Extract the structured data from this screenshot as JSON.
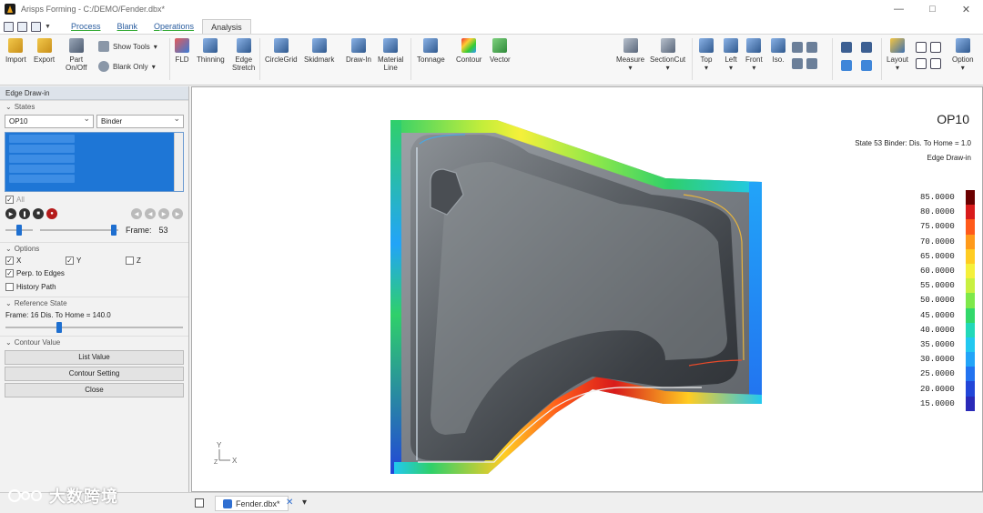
{
  "window": {
    "title": "Arisps Forming - C:/DEMO/Fender.dbx*",
    "minimize": "—",
    "maximize": "□",
    "close": "✕"
  },
  "menu": {
    "tabs": [
      "Process",
      "Blank",
      "Operations",
      "Analysis"
    ],
    "active_tab": "Analysis"
  },
  "ribbon": {
    "import": "Import",
    "export": "Export",
    "part_onoff": [
      "Part",
      "On/Off"
    ],
    "show_tools": "Show Tools",
    "blank_only": "Blank Only",
    "fld": "FLD",
    "thinning": "Thinning",
    "edge_stretch": [
      "Edge",
      "Stretch"
    ],
    "circlegrid": "CircleGrid",
    "skidmark": "Skidmark",
    "drawin": "Draw-In",
    "material_line": [
      "Material",
      "Line"
    ],
    "tonnage": "Tonnage",
    "contour": "Contour",
    "vector": "Vector",
    "measure": "Measure",
    "sectioncut": "SectionCut",
    "top": "Top",
    "left": "Left",
    "front": "Front",
    "iso": "Iso.",
    "layout": "Layout",
    "option": "Option"
  },
  "panel": {
    "title": "Edge Draw-in",
    "states": "States",
    "op_select": "OP10",
    "binder_select": "Binder",
    "all_label": "All",
    "frame_label": "Frame:",
    "frame_value": "53",
    "options": "Options",
    "x": "X",
    "y": "Y",
    "z": "Z",
    "perp": "Perp. to Edges",
    "history": "History Path",
    "reference_state": "Reference State",
    "ref_frame": "Frame:  16  Dis. To Home = 140.0",
    "contour_value": "Contour Value",
    "list_value": "List Value",
    "contour_setting": "Contour Setting",
    "close": "Close"
  },
  "viewport": {
    "op_label": "OP10",
    "state_line": "State 53   Binder: Dis. To Home = 1.0",
    "mode_line": "Edge Draw-in",
    "axis_y": "Y",
    "axis_x": "X",
    "axis_z": "Z"
  },
  "legend": {
    "values": [
      "85.0000",
      "80.0000",
      "75.0000",
      "70.0000",
      "65.0000",
      "60.0000",
      "55.0000",
      "50.0000",
      "45.0000",
      "40.0000",
      "35.0000",
      "30.0000",
      "25.0000",
      "20.0000",
      "15.0000"
    ],
    "colors": [
      "#6b0000",
      "#d81b1b",
      "#ff5a1a",
      "#ff9a1a",
      "#ffcc22",
      "#f5f03a",
      "#c8f040",
      "#7ee84a",
      "#32d86a",
      "#22d8b8",
      "#22c8f0",
      "#22a4f8",
      "#2273f0",
      "#2246d8",
      "#2a2ab8"
    ]
  },
  "statusbar": {
    "file": "Fender.dbx*",
    "close": "✕",
    "caret": "▾"
  },
  "watermark": "大数跨境"
}
